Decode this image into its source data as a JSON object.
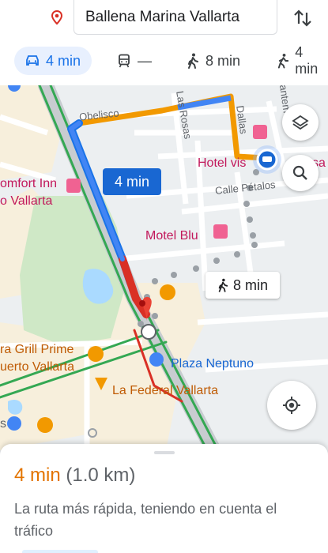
{
  "header": {
    "destination": "Ballena Marina Vallarta",
    "modes": [
      {
        "name": "drive",
        "time": "4 min",
        "selected": true
      },
      {
        "name": "transit",
        "time": "—",
        "selected": false
      },
      {
        "name": "walk",
        "time": "8 min",
        "selected": false
      },
      {
        "name": "bike",
        "time": "4 min",
        "selected": false
      }
    ]
  },
  "map": {
    "drive_callout": "4 min",
    "walk_callout": "8 min",
    "labels": {
      "obelisco": "Obelisco",
      "las_rosas": "Las Rosas",
      "dallas": "Dallas",
      "santemo": "santemo",
      "comfort_inn_1": "omfort Inn",
      "comfort_inn_2": "o Vallarta",
      "hotel_vis": "Hotel vis",
      "hotel_vis_tail": "sa",
      "calle_petalos": "Calle Pétalos",
      "motel_blu": "Motel Blu",
      "grill_1": "ra Grill Prime",
      "grill_2": "uerto Vallarta",
      "plaza_neptuno": "Plaza Neptuno",
      "la_federal": "La Federal Vallarta",
      "edge_s": "s"
    },
    "colors": {
      "route_blue": "#4285f4",
      "route_red": "#d93025",
      "traffic_orange": "#f29900",
      "park_green": "#cfe8c6",
      "water": "#aadaff",
      "pin_red": "#ea4335"
    }
  },
  "sheet": {
    "time": "4 min",
    "distance": "(1.0 km)",
    "description": "La ruta más rápida, teniendo en cuenta el tráfico"
  },
  "icons": [
    "location-pin-icon",
    "swap-icon",
    "car-icon",
    "transit-icon",
    "walk-icon",
    "bike-icon",
    "layers-icon",
    "search-icon",
    "my-location-icon"
  ]
}
